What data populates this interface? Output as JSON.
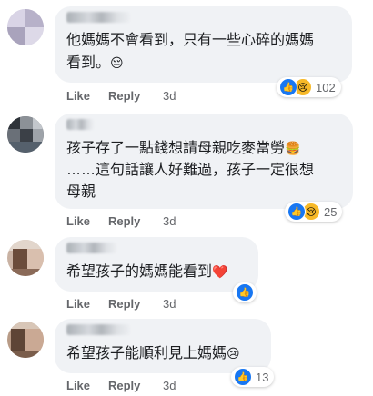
{
  "comments": [
    {
      "text_lines": [
        "他媽媽不會看到，只有一些心碎的媽媽",
        "看到。"
      ],
      "emoji": "😔",
      "reaction_count": "102",
      "like_label": "Like",
      "reply_label": "Reply",
      "time": "3d"
    },
    {
      "text_lines": [
        "孩子存了一點錢想請母親吃麥當勞",
        "……這句話讓人好難過，孩子一定很想",
        "母親"
      ],
      "emoji": "🍔",
      "reaction_count": "25",
      "like_label": "Like",
      "reply_label": "Reply",
      "time": "3d"
    },
    {
      "text_lines": [
        "希望孩子的媽媽能看到"
      ],
      "emoji": "❤️",
      "reaction_count": "",
      "like_label": "Like",
      "reply_label": "Reply",
      "time": "3d"
    },
    {
      "text_lines": [
        "希望孩子能順利見上媽媽"
      ],
      "emoji": "😢",
      "reaction_count": "13",
      "like_label": "Like",
      "reply_label": "Reply",
      "time": "3d"
    }
  ],
  "icons": {
    "like": "thumbs-up-icon",
    "sad": "sad-face-icon"
  },
  "colors": {
    "like_blue": "#1877f2",
    "bubble_bg": "#f0f2f5",
    "meta_gray": "#65676b"
  }
}
